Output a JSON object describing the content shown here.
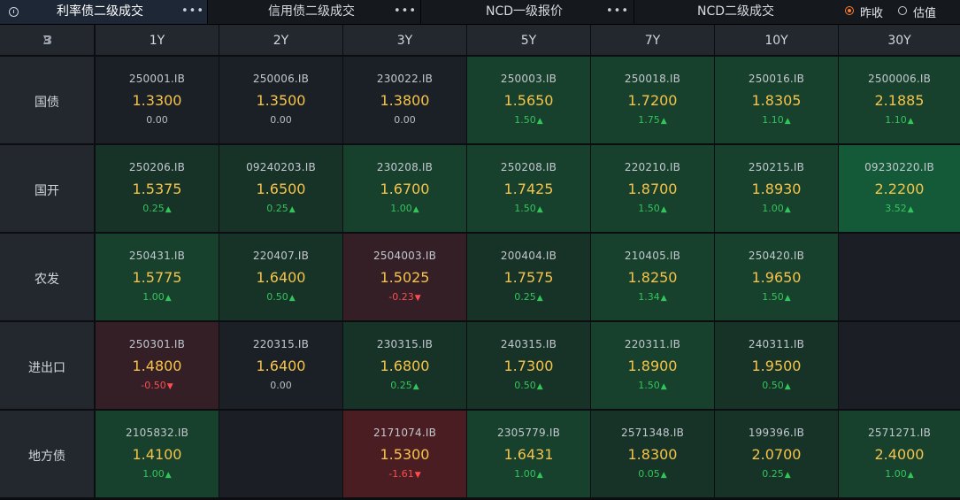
{
  "tabs": [
    {
      "label": "利率债二级成交",
      "more": "•••",
      "active": true
    },
    {
      "label": "信用债二级成交",
      "more": "•••",
      "active": false
    },
    {
      "label": "NCD一级报价",
      "more": "•••",
      "active": false
    },
    {
      "label": "NCD二级成交",
      "more": "",
      "active": false
    }
  ],
  "radios": [
    {
      "label": "昨收",
      "checked": true
    },
    {
      "label": "估值",
      "checked": false
    }
  ],
  "columns": [
    "1Y",
    "2Y",
    "3Y",
    "5Y",
    "7Y",
    "10Y",
    "30Y"
  ],
  "rows": [
    {
      "label": "国债",
      "cells": [
        {
          "code": "250001.IB",
          "rate": "1.3300",
          "change": "0.00",
          "dir": "flat"
        },
        {
          "code": "250006.IB",
          "rate": "1.3500",
          "change": "0.00",
          "dir": "flat"
        },
        {
          "code": "230022.IB",
          "rate": "1.3800",
          "change": "0.00",
          "dir": "flat"
        },
        {
          "code": "250003.IB",
          "rate": "1.5650",
          "change": "1.50",
          "dir": "up"
        },
        {
          "code": "250018.IB",
          "rate": "1.7200",
          "change": "1.75",
          "dir": "up"
        },
        {
          "code": "250016.IB",
          "rate": "1.8305",
          "change": "1.10",
          "dir": "up"
        },
        {
          "code": "2500006.IB",
          "rate": "2.1885",
          "change": "1.10",
          "dir": "up"
        }
      ]
    },
    {
      "label": "国开",
      "cells": [
        {
          "code": "250206.IB",
          "rate": "1.5375",
          "change": "0.25",
          "dir": "up"
        },
        {
          "code": "09240203.IB",
          "rate": "1.6500",
          "change": "0.25",
          "dir": "up"
        },
        {
          "code": "230208.IB",
          "rate": "1.6700",
          "change": "1.00",
          "dir": "up"
        },
        {
          "code": "250208.IB",
          "rate": "1.7425",
          "change": "1.50",
          "dir": "up"
        },
        {
          "code": "220210.IB",
          "rate": "1.8700",
          "change": "1.50",
          "dir": "up"
        },
        {
          "code": "250215.IB",
          "rate": "1.8930",
          "change": "1.00",
          "dir": "up"
        },
        {
          "code": "09230220.IB",
          "rate": "2.2200",
          "change": "3.52",
          "dir": "up"
        }
      ]
    },
    {
      "label": "农发",
      "cells": [
        {
          "code": "250431.IB",
          "rate": "1.5775",
          "change": "1.00",
          "dir": "up"
        },
        {
          "code": "220407.IB",
          "rate": "1.6400",
          "change": "0.50",
          "dir": "up"
        },
        {
          "code": "2504003.IB",
          "rate": "1.5025",
          "change": "-0.23",
          "dir": "down"
        },
        {
          "code": "200404.IB",
          "rate": "1.7575",
          "change": "0.25",
          "dir": "up"
        },
        {
          "code": "210405.IB",
          "rate": "1.8250",
          "change": "1.34",
          "dir": "up"
        },
        {
          "code": "250420.IB",
          "rate": "1.9650",
          "change": "1.50",
          "dir": "up"
        },
        null
      ]
    },
    {
      "label": "进出口",
      "cells": [
        {
          "code": "250301.IB",
          "rate": "1.4800",
          "change": "-0.50",
          "dir": "down"
        },
        {
          "code": "220315.IB",
          "rate": "1.6400",
          "change": "0.00",
          "dir": "flat"
        },
        {
          "code": "230315.IB",
          "rate": "1.6800",
          "change": "0.25",
          "dir": "up"
        },
        {
          "code": "240315.IB",
          "rate": "1.7300",
          "change": "0.50",
          "dir": "up"
        },
        {
          "code": "220311.IB",
          "rate": "1.8900",
          "change": "1.50",
          "dir": "up"
        },
        {
          "code": "240311.IB",
          "rate": "1.9500",
          "change": "0.50",
          "dir": "up"
        },
        null
      ]
    },
    {
      "label": "地方债",
      "cells": [
        {
          "code": "2105832.IB",
          "rate": "1.4100",
          "change": "1.00",
          "dir": "up"
        },
        null,
        {
          "code": "2171074.IB",
          "rate": "1.5300",
          "change": "-1.61",
          "dir": "down"
        },
        {
          "code": "2305779.IB",
          "rate": "1.6431",
          "change": "1.00",
          "dir": "up"
        },
        {
          "code": "2571348.IB",
          "rate": "1.8300",
          "change": "0.05",
          "dir": "up"
        },
        {
          "code": "199396.IB",
          "rate": "2.0700",
          "change": "0.25",
          "dir": "up"
        },
        {
          "code": "2571271.IB",
          "rate": "2.4000",
          "change": "1.00",
          "dir": "up"
        }
      ]
    }
  ],
  "symbols": {
    "up": "▲",
    "down": "▼"
  },
  "colors": {
    "flat_bg": "#1b2027",
    "empty_bg": "#1b1f25",
    "up_light": "#173227",
    "up_mid": "#17402d",
    "up_strong": "#155a38",
    "down_light": "#331f25",
    "down_strong": "#4a1d22",
    "rate_text": "#f6c34a",
    "up_text": "#32c65a",
    "down_text": "#ff4d4f",
    "radio_accent": "#ff7a2f"
  }
}
